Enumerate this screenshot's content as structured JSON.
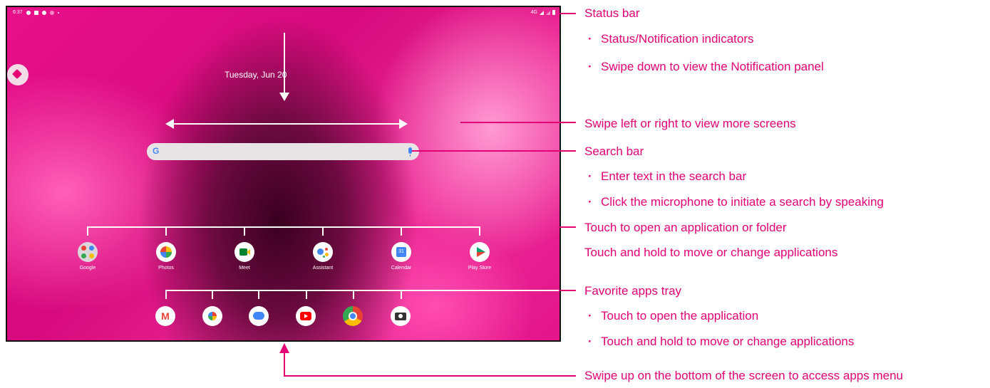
{
  "status_bar": {
    "time": "6:37",
    "network": "4G"
  },
  "home": {
    "date": "Tuesday, Jun 20",
    "search": {
      "logo": "G"
    },
    "apps": [
      {
        "label": "Google",
        "icon": "google-folder-icon"
      },
      {
        "label": "Photos",
        "icon": "photos-icon"
      },
      {
        "label": "Meet",
        "icon": "meet-icon"
      },
      {
        "label": "Assistant",
        "icon": "assistant-icon"
      },
      {
        "label": "Calendar",
        "icon": "calendar-icon",
        "badge": "31"
      },
      {
        "label": "Play Store",
        "icon": "play-store-icon"
      }
    ],
    "dock": [
      {
        "icon": "gmail-icon",
        "glyph": "M"
      },
      {
        "icon": "photos-icon"
      },
      {
        "icon": "messages-icon"
      },
      {
        "icon": "youtube-icon"
      },
      {
        "icon": "chrome-icon"
      },
      {
        "icon": "camera-icon"
      }
    ]
  },
  "annotations": {
    "status_bar": "Status bar",
    "status_b1": "Status/Notification indicators",
    "status_b2": "Swipe down to view the Notification panel",
    "swipe_lr": "Swipe left or right to view more screens",
    "search_bar": "Search bar",
    "search_b1": "Enter text in the search bar",
    "search_b2": "Click the microphone to initiate a search by speaking",
    "apps_1": "Touch to open an application or folder",
    "apps_2": "Touch and hold to move or change applications",
    "fav": "Favorite apps tray",
    "fav_b1": "Touch to open the application",
    "fav_b2": "Touch and hold to move or change applications",
    "swipe_up": "Swipe up on the bottom of the screen to access apps menu"
  },
  "colors": {
    "accent": "#e20074"
  }
}
